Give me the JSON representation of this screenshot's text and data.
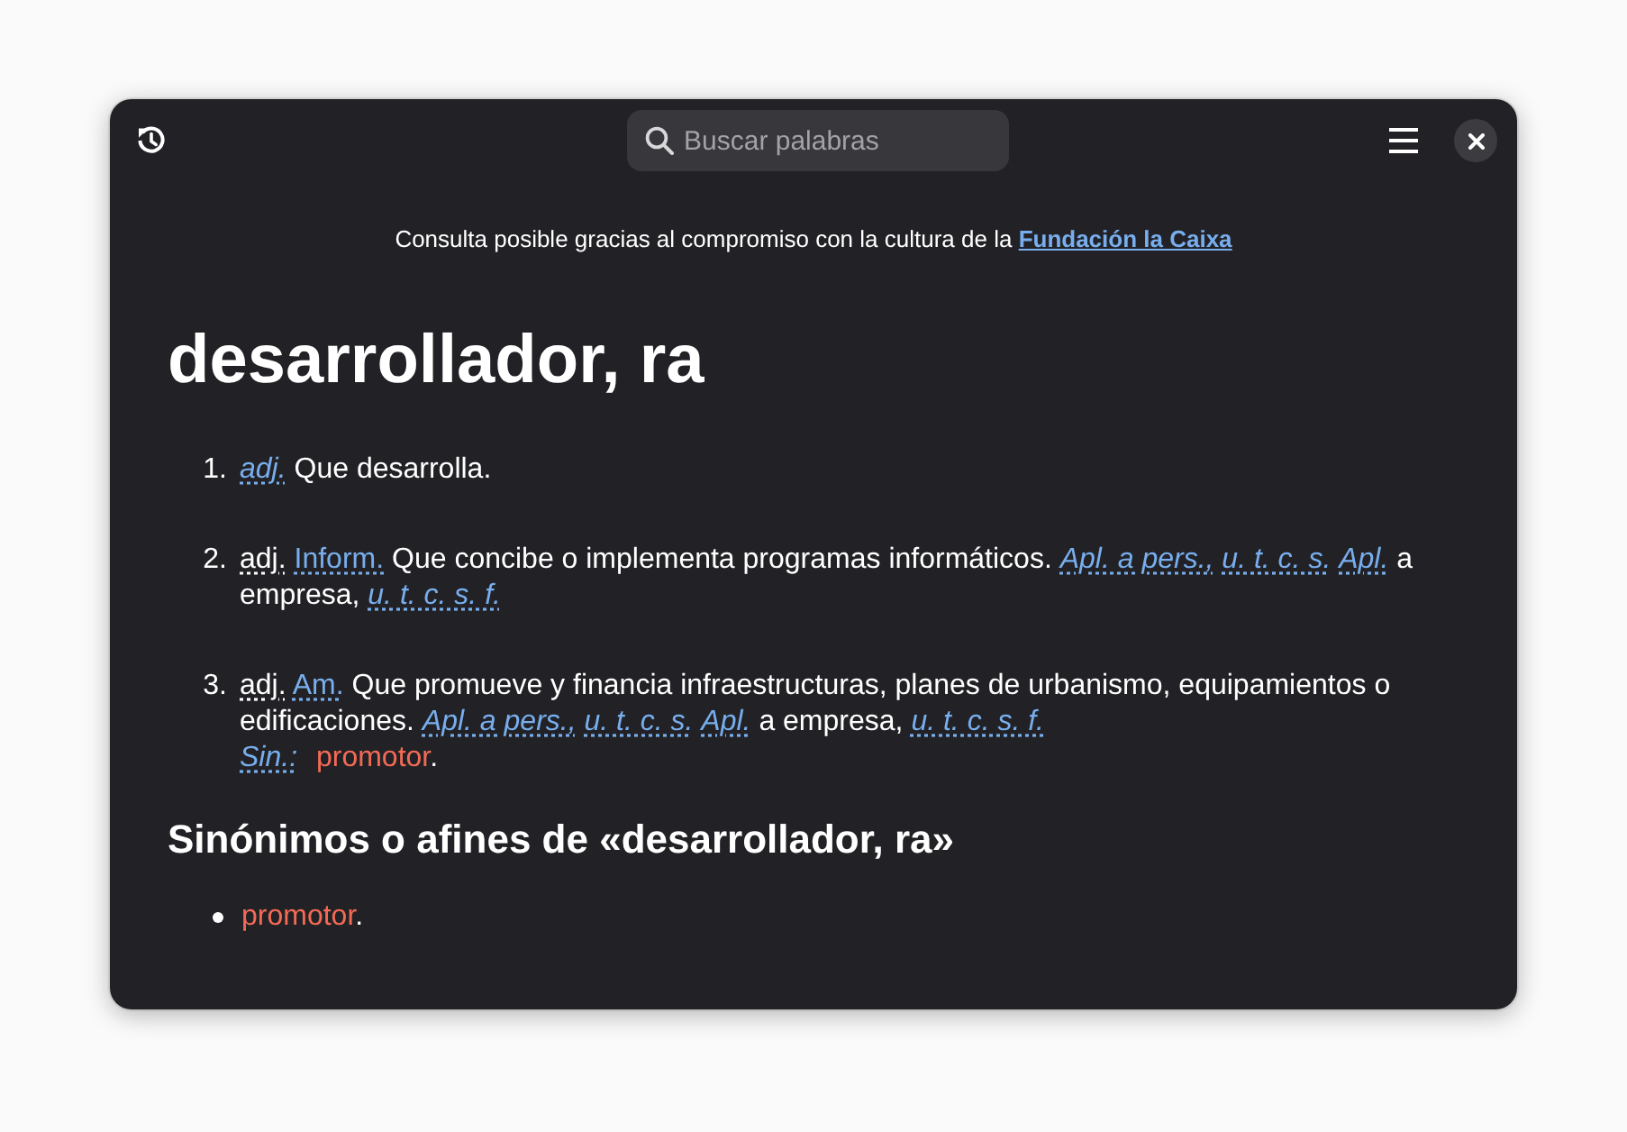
{
  "header_bar": {
    "search": {
      "placeholder": "Buscar palabras"
    }
  },
  "sponsor": {
    "text": "Consulta posible gracias al compromiso con la cultura de la",
    "link": "Fundación la Caixa"
  },
  "entry": {
    "headword": "desarrollador, ra",
    "definitions": [
      {
        "number": "1.",
        "segments": [
          {
            "kind": "note",
            "text": "adj."
          },
          {
            "kind": "text",
            "text": "Que desarrolla."
          }
        ]
      },
      {
        "number": "2.",
        "segments": [
          {
            "kind": "grammar",
            "text": "adj."
          },
          {
            "kind": "field",
            "text": "Inform."
          },
          {
            "kind": "text",
            "text": "Que concibe o implementa programas informáticos."
          },
          {
            "kind": "note",
            "text": "Apl. a pers.,"
          },
          {
            "kind": "note",
            "text": "u. t. c. s."
          },
          {
            "kind": "note",
            "text": "Apl."
          },
          {
            "kind": "text",
            "text": "a empresa,"
          },
          {
            "kind": "note",
            "text": "u. t. c. s. f."
          }
        ]
      },
      {
        "number": "3.",
        "segments": [
          {
            "kind": "grammar",
            "text": "adj."
          },
          {
            "kind": "field",
            "text": "Am."
          },
          {
            "kind": "text",
            "text": "Que promueve y financia infraestructuras, planes de urbanismo, equipamientos o edificaciones."
          },
          {
            "kind": "note",
            "text": "Apl. a pers.,"
          },
          {
            "kind": "note",
            "text": "u. t. c. s."
          },
          {
            "kind": "note",
            "text": "Apl."
          },
          {
            "kind": "text",
            "text": "a empresa,"
          },
          {
            "kind": "note",
            "text": "u. t. c. s. f."
          }
        ],
        "synonym_line": {
          "label": "Sin.:",
          "words": [
            {
              "word": "promotor",
              "after": "."
            }
          ]
        }
      }
    ]
  },
  "synonyms": {
    "heading": "Sinónimos o afines de «desarrollador, ra»",
    "items": [
      {
        "word": "promotor",
        "after": "."
      }
    ]
  }
}
